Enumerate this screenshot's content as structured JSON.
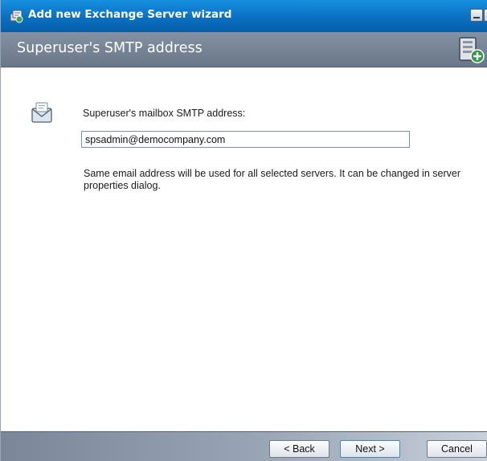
{
  "window": {
    "title": "Add new Exchange Server wizard"
  },
  "header": {
    "title": "Superuser's SMTP address",
    "icon": "server-add-icon"
  },
  "form": {
    "icon": "mailbox-icon",
    "label": "Superuser's mailbox SMTP address:",
    "smtp_value": "spsadmin@democompany.com",
    "note": "Same email address will be used for all selected servers. It can be changed in server properties dialog."
  },
  "buttons": {
    "back": "< Back",
    "next": "Next >",
    "cancel": "Cancel"
  },
  "colors": {
    "titlebar": "#0a6fc2",
    "header": "#7a8798",
    "footer": "#8f9bab"
  }
}
